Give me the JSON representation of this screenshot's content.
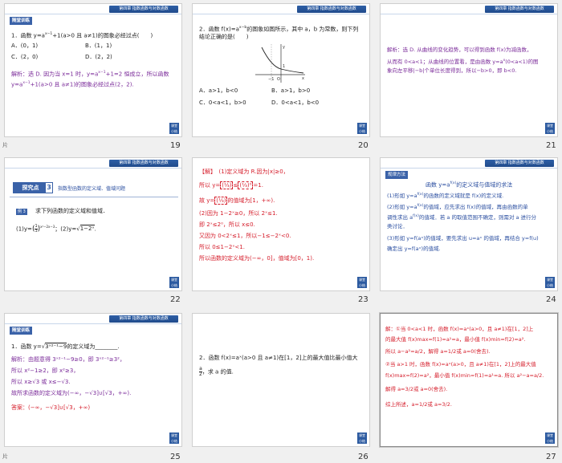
{
  "header_text": "第四章  指数函数与对数函数",
  "badge_text": "随堂训练",
  "nav_button": "课堂 小结",
  "slides": [
    {
      "page": "19",
      "side_label": "片",
      "q_line1": "1．函数 y=a",
      "q_exp1": "x−1",
      "q_line1b": "+1(a>0 且 a≠1)的图象必经过点(　　)",
      "opt_a": "A．(0，1)",
      "opt_b": "B．(1，1)",
      "opt_c": "C．(2，0)",
      "opt_d": "D．(2，2)",
      "sol_1": "解析：选 D. 因为当 x=1 时，y=a",
      "sol_exp": "x−1",
      "sol_1b": "+1=2 恒成立，所以函数",
      "sol_2": "y=a",
      "sol_2b": "+1(a>0 且 a≠1)的图象必经过点(2，2)."
    },
    {
      "page": "20",
      "q_line1": "2．函数 f(x)=a",
      "q_exp": "x−b",
      "q_line1b": "的图象如图所示，其中 a，b 为常数，则下列",
      "q_line2": "结论正确的是(　　)",
      "opt_a": "A．a>1，b<0",
      "opt_b": "B．a>1，b>0",
      "opt_c": "C．0<a<1，b>0",
      "opt_d": "D．0<a<1，b<0",
      "graph_y": "y",
      "graph_x": "x",
      "graph_1": "1",
      "graph_neg1": "−1",
      "graph_o": "O"
    },
    {
      "page": "21",
      "sol_1": "解析：选 D. 从曲线的变化趋势，可以得到函数 f(x)为减函数，",
      "sol_2": "从而有 0<a<1；从曲线的位置看，是由函数 y=a",
      "sol_2exp": "x",
      "sol_2b": "(0<a<1)的图",
      "sol_3": "象向左平移|−b|个单位长度得到，所以−b>0，即 b<0."
    },
    {
      "page": "22",
      "topic_label": "探究点",
      "topic_num": "3",
      "topic_title": "指数型函数的定义域、值域问题",
      "example_tag": "例 3",
      "example_text": "求下列函数的定义域和值域．",
      "part1": "(1)y=",
      "part1_exp": "x²−2x−3",
      "part1_num": "1",
      "part1_den": "3",
      "part2": "；(2)y=",
      "part2_rad": "1−2ˣ",
      "part2_end": "."
    },
    {
      "page": "23",
      "l1": "【解】　(1)定义域为 R.因为|x|≥0，",
      "l2a": "所以 y=",
      "l2b": "≤",
      "l2c": "=1.",
      "l3": "故 y=",
      "l3b": "的值域为[1，+∞).",
      "l4": "(2)因为 1−2ˣ≥0，所以 2ˣ≤1.",
      "l5": "即 2ˣ≤2⁰，所以 x≤0.",
      "l6": "又因为 0<2ˣ≤1，所以−1≤−2ˣ<0.",
      "l7": "所以 0≤1−2ˣ<1.",
      "l8": "所以函数的定义域为(−∞，0]，值域为[0，1)."
    },
    {
      "page": "24",
      "method_tag": "规律方法",
      "title_a": "函数 y=a",
      "title_exp": "f(x)",
      "title_b": "的定义域与值域的求法",
      "m1": "(1)形如 y=a",
      "m1exp": "f(x)",
      "m1b": "的函数的定义域就是 f(x)的定义域.",
      "m2": "(2)形如 y=a",
      "m2exp": "f(x)",
      "m2b": "的值域，应先求出 f(x)的值域，再由函数的单",
      "m3": "调性求出 a",
      "m3exp": "f(x)",
      "m3b": "的值域．若 a 的取值范围不确定，则需对 a 进行分",
      "m4": "类讨论．",
      "m5": "(3)形如 y=f(aˣ)的值域，要先求出 u=aˣ 的值域，再结合 y=f(u)",
      "m6": "确定出 y=f(aˣ)的值域."
    },
    {
      "page": "25",
      "side_label": "片",
      "q": "1．函数 y=",
      "q_rad": "3ˣ²⁻¹−9",
      "q_end": "的定义域为________.",
      "s1": "解析：由题意得 3ˣ²⁻¹−9≥0，即 3ˣ²⁻¹≥3²，",
      "s2": "所以 x²−1≥2，即 x²≥3，",
      "s3": "所以 x≥√3 或 x≤−√3.",
      "s4": "故所求函数的定义域为(−∞，−√3]∪[√3，+∞).",
      "ans": "答案：(−∞，−√3]∪[√3，+∞)"
    },
    {
      "page": "26",
      "q1": "2．函数 f(x)=aˣ(a>0 且 a≠1)在[1，2]上的最大值比最小值大",
      "q2a": "a",
      "q2b": "2",
      "q2c": "，求 a 的值."
    },
    {
      "page": "27",
      "l1": "解：①当 0<a<1 时，函数 f(x)=aˣ(a>0，且 a≠1)在[1，2]上",
      "l2": "的最大值 f(x)max=f(1)=a¹=a，最小值 f(x)min=f(2)=a².",
      "l3": "所以 a−a²=",
      "l3f": "a/2",
      "l3b": "，解得 a=",
      "l3c": "1/2",
      "l3d": "或 a=0(舍去).",
      "l4": "②当 a>1 时，函数 f(x)=aˣ(a>0，且 a≠1)在[1，2]上的最大值",
      "l5": "f(x)max=f(2)=a²，最小值 f(x)min=f(1)=a¹=a. 所以 a²−a=",
      "l5f": "a/2",
      "l5b": ".",
      "l6": "解得 a=",
      "l6f": "3/2",
      "l6b": "或 a=0(舍去).",
      "l7": "综上所述，a=",
      "l7f": "1/2",
      "l7b": "或 a=",
      "l7g": "3/2",
      "l7c": "."
    }
  ]
}
